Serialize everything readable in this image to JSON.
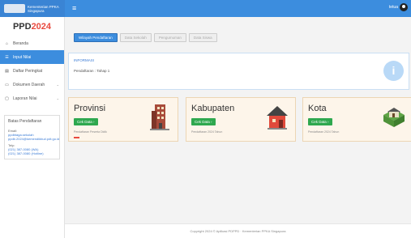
{
  "header": {
    "brand_text": "Kementerian PPKA Singapura",
    "menu_icon": "hamburger-icon",
    "user_name": "tetua",
    "accent": "#3c8dde"
  },
  "sidebar": {
    "logo_prefix": "PPD",
    "logo_year": "2024",
    "items": [
      {
        "label": "Beranda",
        "icon": "home-icon"
      },
      {
        "label": "Input Nilai",
        "icon": "list-icon",
        "active": true
      },
      {
        "label": "Daftar Peringkat",
        "icon": "document-icon"
      },
      {
        "label": "Dokumen Daerah",
        "icon": "folder-icon",
        "chevron": true
      },
      {
        "label": "Laporan Nilai",
        "icon": "monitor-icon",
        "chevron": true
      }
    ],
    "info": {
      "title": "Batas Pendaftaran",
      "label1": "Email:",
      "value1": "ppdbtaga.sekolah",
      "value2": "ppdb.2024@kemendikbud.pdt.go.id",
      "label2": "Telp:",
      "value3": "(021) 387-0080 (WA)",
      "value4": "(021) 387-0080 (Hotline)"
    }
  },
  "tabs": [
    {
      "label": "Wilayah Pendaftaran",
      "active": true
    },
    {
      "label": "Data Sekolah",
      "active": false
    },
    {
      "label": "Pengumuman",
      "active": false
    },
    {
      "label": "Data Siswa",
      "active": false
    }
  ],
  "info_panel": {
    "title": "INFORMASI",
    "body": "Pendaftaran : Tahap 1",
    "icon": "info-icon"
  },
  "cards": [
    {
      "title": "Provinsi",
      "button": "Cek Data ›",
      "sub": "Pendaftaran Peserta Didik",
      "icon": "building-icon",
      "bar_color": "#e94a3f"
    },
    {
      "title": "Kabupaten",
      "button": "Cek Data ›",
      "sub": "Pendaftaran 2024 Tahun",
      "icon": "house-icon"
    },
    {
      "title": "Kota",
      "button": "Cek Data ›",
      "sub": "Pendaftaran 2024 Tahun",
      "icon": "cottage-icon"
    }
  ],
  "footer": {
    "text": "Copyright 2024 © Aplikasi PDPPD · Kementerian PPKA Singapura"
  }
}
